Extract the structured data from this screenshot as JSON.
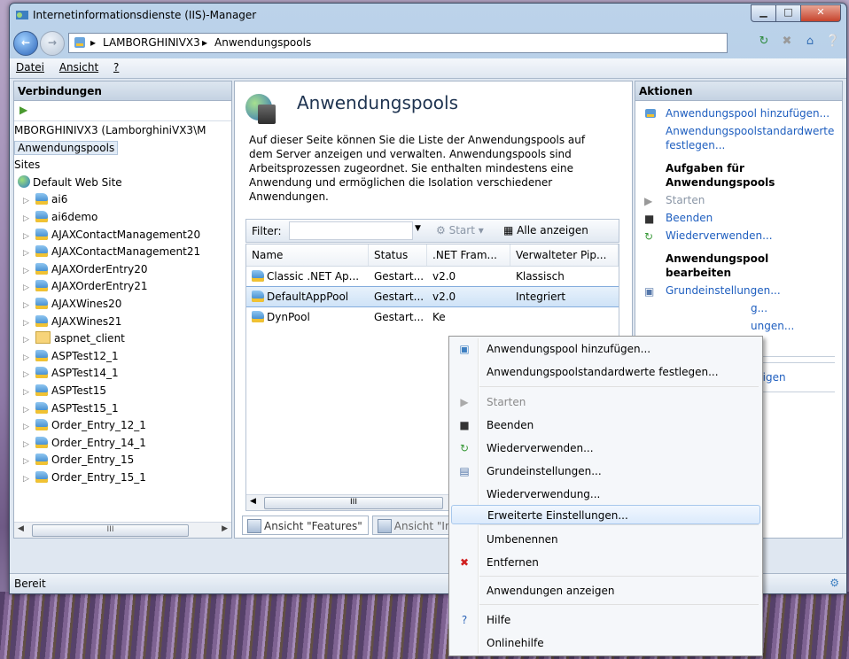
{
  "window": {
    "title": "Internetinformationsdienste (IIS)-Manager",
    "controls": {
      "minimize": "▁",
      "maximize": "□",
      "close": "✕"
    }
  },
  "address": {
    "crumbs": [
      "LAMBORGHINIVX3",
      "Anwendungspools"
    ],
    "separator": "▸"
  },
  "menu": [
    "Datei",
    "Ansicht",
    "?"
  ],
  "connections": {
    "header": "Verbindungen",
    "server": "MBORGHINIVX3 (LamborghiniVX3\\M",
    "selected": "Anwendungspools",
    "sites": "Sites",
    "site": "Default Web Site",
    "items": [
      "ai6",
      "ai6demo",
      "AJAXContactManagement20",
      "AJAXContactManagement21",
      "AJAXOrderEntry20",
      "AJAXOrderEntry21",
      "AJAXWines20",
      "AJAXWines21",
      "aspnet_client",
      "ASPTest12_1",
      "ASPTest14_1",
      "ASPTest15",
      "ASPTest15_1",
      "Order_Entry_12_1",
      "Order_Entry_14_1",
      "Order_Entry_15",
      "Order_Entry_15_1"
    ],
    "scroll_thumb": "III"
  },
  "main": {
    "title": "Anwendungspools",
    "description": "Auf dieser Seite können Sie die Liste der Anwendungspools auf dem Server anzeigen und verwalten. Anwendungspools sind Arbeitsprozessen zugeordnet. Sie enthalten mindestens eine Anwendung und ermöglichen die Isolation verschiedener Anwendungen.",
    "filter_label": "Filter:",
    "start_label": "Start",
    "show_all_label": "Alle anzeigen",
    "columns": [
      "Name",
      "Status",
      ".NET Fram...",
      "Verwalteter Pip..."
    ],
    "rows": [
      [
        "Classic .NET Ap...",
        "Gestart...",
        "v2.0",
        "Klassisch"
      ],
      [
        "DefaultAppPool",
        "Gestart...",
        "v2.0",
        "Integriert"
      ],
      [
        "DynPool",
        "Gestart...",
        "Ke",
        ""
      ]
    ],
    "selected_row": 1,
    "scroll_thumb": "III",
    "tabs": [
      "Ansicht \"Features\"",
      "Ansicht \"Int"
    ]
  },
  "actions": {
    "header": "Aktionen",
    "add_pool": "Anwendungspool hinzufügen...",
    "defaults": "Anwendungspoolstandardwerte festlegen...",
    "tasks_head": "Aufgaben für Anwendungspools",
    "start": "Starten",
    "stop": "Beenden",
    "recycle": "Wiederverwenden...",
    "edit_head": "Anwendungspool bearbeiten",
    "basic": "Grundeinstellungen...",
    "recycling_part": "g...",
    "advanced_part": "ungen...",
    "show_apps_part": "zeigen"
  },
  "context_menu": {
    "items": [
      {
        "label": "Anwendungspool hinzufügen...",
        "icon": "pool-icon",
        "disabled": false
      },
      {
        "label": "Anwendungspoolstandardwerte festlegen...",
        "icon": "",
        "disabled": false
      },
      {
        "label": "Starten",
        "icon": "play-icon",
        "disabled": true
      },
      {
        "label": "Beenden",
        "icon": "stop-icon",
        "disabled": false
      },
      {
        "label": "Wiederverwenden...",
        "icon": "recycle-icon",
        "disabled": false
      },
      {
        "label": "Grundeinstellungen...",
        "icon": "settings-icon",
        "disabled": false
      },
      {
        "label": "Wiederverwendung...",
        "icon": "",
        "disabled": false
      },
      {
        "label": "Erweiterte Einstellungen...",
        "icon": "",
        "disabled": false,
        "highlighted": true
      },
      {
        "label": "Umbenennen",
        "icon": "",
        "disabled": false
      },
      {
        "label": "Entfernen",
        "icon": "remove-icon",
        "disabled": false
      },
      {
        "label": "Anwendungen anzeigen",
        "icon": "",
        "disabled": false
      },
      {
        "label": "Hilfe",
        "icon": "help-icon",
        "disabled": false
      },
      {
        "label": "Onlinehilfe",
        "icon": "",
        "disabled": false
      }
    ]
  },
  "status": {
    "text": "Bereit"
  },
  "colors": {
    "link": "#1e5ebf",
    "highlight": "#dbeafc",
    "close": "#c6432c"
  }
}
